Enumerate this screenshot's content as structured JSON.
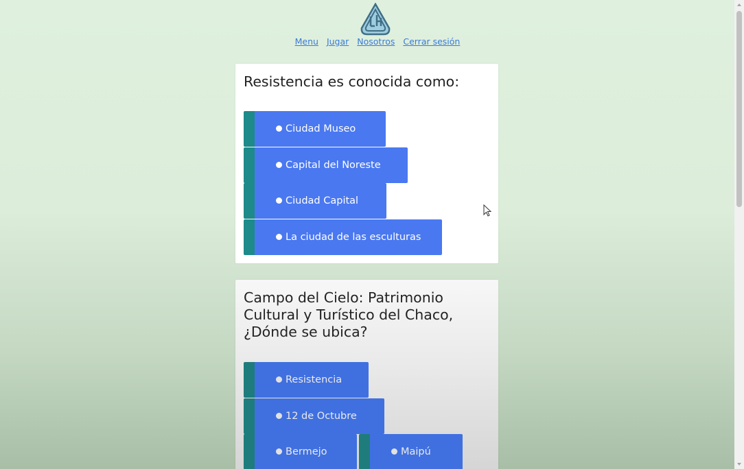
{
  "nav": {
    "menu": "Menu",
    "jugar": "Jugar",
    "nosotros": "Nosotros",
    "cerrar": "Cerrar sesión"
  },
  "logo": {
    "icon": "app-logo-icon",
    "color": "#4a8aa8"
  },
  "questions": [
    {
      "text": "Resistencia es conocida como:",
      "options": [
        "Ciudad Museo",
        "Capital del Noreste",
        "Ciudad Capital",
        "La ciudad de las esculturas"
      ]
    },
    {
      "text": "Campo del Cielo: Patrimonio Cultural y Turístico del Chaco, ¿Dónde se ubica?",
      "options": [
        "Resistencia",
        "12 de Octubre",
        "Bermejo",
        "Maipú"
      ]
    }
  ],
  "colors": {
    "option_blue": "#4a78f0",
    "option_accent": "#1e8a8a",
    "link": "#3a7ad8",
    "background": "#dff0de"
  }
}
